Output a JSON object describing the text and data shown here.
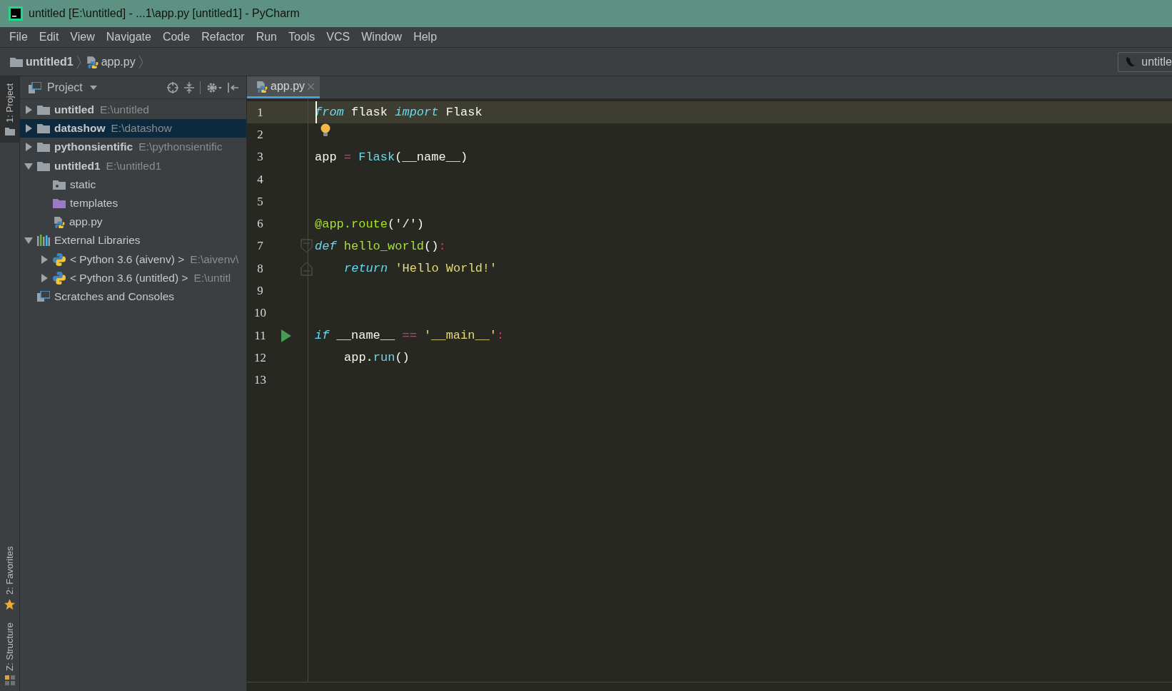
{
  "window": {
    "title": "untitled [E:\\untitled] - ...1\\app.py [untitled1] - PyCharm"
  },
  "menu": [
    "File",
    "Edit",
    "View",
    "Navigate",
    "Code",
    "Refactor",
    "Run",
    "Tools",
    "VCS",
    "Window",
    "Help"
  ],
  "breadcrumbs": [
    {
      "label": "untitled1",
      "kind": "folder"
    },
    {
      "label": "app.py",
      "kind": "python-file"
    }
  ],
  "run_config": {
    "label": "untitle"
  },
  "tool_strip": [
    {
      "label": "1: Project",
      "selected": true,
      "kind": "project"
    },
    {
      "label": "2: Favorites",
      "selected": false,
      "kind": "favorites"
    },
    {
      "label": "Z: Structure",
      "selected": false,
      "kind": "structure"
    }
  ],
  "project_panel": {
    "title": "Project",
    "tree": [
      {
        "name": "untitled",
        "path": "E:\\untitled",
        "kind": "project",
        "expanded": false,
        "selected": false
      },
      {
        "name": "datashow",
        "path": "E:\\datashow",
        "kind": "project",
        "expanded": false,
        "selected": true
      },
      {
        "name": "pythonsientific",
        "path": "E:\\pythonsientific",
        "kind": "project",
        "expanded": false,
        "selected": false
      },
      {
        "name": "untitled1",
        "path": "E:\\untitled1",
        "kind": "project",
        "expanded": true,
        "selected": false,
        "children": [
          {
            "name": "static",
            "kind": "resource-folder",
            "selected": false
          },
          {
            "name": "templates",
            "kind": "template-folder",
            "selected": false
          },
          {
            "name": "app.py",
            "kind": "python-file",
            "selected": false
          }
        ]
      },
      {
        "name": "External Libraries",
        "kind": "libraries",
        "expanded": true,
        "selected": false,
        "children": [
          {
            "name": "< Python 3.6 (aivenv) >",
            "path": "E:\\aivenv\\",
            "kind": "python-sdk",
            "expanded": false,
            "selected": false
          },
          {
            "name": "< Python 3.6 (untitled) >",
            "path": "E:\\untitl",
            "kind": "python-sdk",
            "expanded": false,
            "selected": false
          }
        ]
      },
      {
        "name": "Scratches and Consoles",
        "kind": "scratches",
        "selected": false
      }
    ]
  },
  "editor_tabs": [
    {
      "label": "app.py",
      "selected": true
    }
  ],
  "code": [
    {
      "number": "1",
      "current": true,
      "tokens": [
        {
          "text": "from",
          "kind": "keyword"
        },
        {
          "text": " flask ",
          "kind": "plain"
        },
        {
          "text": "import",
          "kind": "keyword"
        },
        {
          "text": " Flask",
          "kind": "plain"
        }
      ]
    },
    {
      "number": "2",
      "hint": true
    },
    {
      "number": "3",
      "tokens": [
        {
          "text": "app ",
          "kind": "plain"
        },
        {
          "text": "=",
          "kind": "operator"
        },
        {
          "text": " Flask",
          "kind": "builtin"
        },
        {
          "text": "(__name__)",
          "kind": "plain"
        }
      ]
    },
    {
      "number": "4"
    },
    {
      "number": "5"
    },
    {
      "number": "6",
      "tokens": [
        {
          "text": "@app.route",
          "kind": "decorator"
        },
        {
          "text": "('/')",
          "kind": "plain"
        }
      ]
    },
    {
      "number": "7",
      "fold_start": true,
      "tokens": [
        {
          "text": "def",
          "kind": "keyword"
        },
        {
          "text": " hello_world",
          "kind": "function"
        },
        {
          "text": "()",
          "kind": "plain"
        },
        {
          "text": ":",
          "kind": "operator"
        }
      ]
    },
    {
      "number": "8",
      "fold_end": true,
      "indented": true,
      "tokens": [
        {
          "text": "return",
          "kind": "keyword"
        },
        {
          "text": " 'Hello World!'",
          "kind": "string"
        }
      ]
    },
    {
      "number": "9"
    },
    {
      "number": "10"
    },
    {
      "number": "11",
      "runnable": true,
      "tokens": [
        {
          "text": "if",
          "kind": "keyword"
        },
        {
          "text": " __name__ ",
          "kind": "plain"
        },
        {
          "text": "==",
          "kind": "operator"
        },
        {
          "text": " '__main__'",
          "kind": "string"
        },
        {
          "text": ":",
          "kind": "operator"
        }
      ]
    },
    {
      "number": "12",
      "indented": true,
      "tokens": [
        {
          "text": "app.",
          "kind": "plain"
        },
        {
          "text": "run",
          "kind": "builtin"
        },
        {
          "text": "()",
          "kind": "plain"
        }
      ]
    },
    {
      "number": "13"
    }
  ]
}
